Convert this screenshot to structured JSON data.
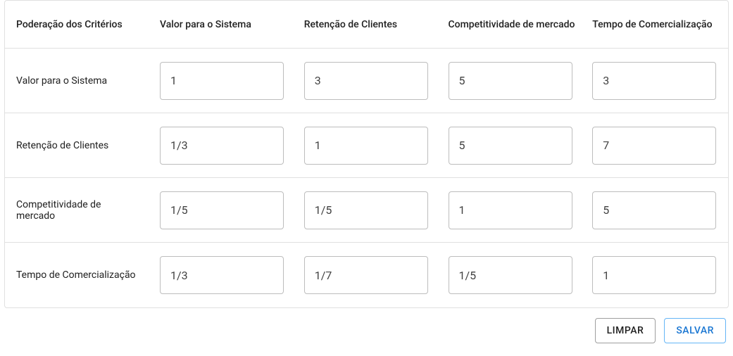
{
  "corner_label": "Poderação dos Critérios",
  "columns": [
    "Valor para o Sistema",
    "Retenção de Clientes",
    "Competitividade de mercado",
    "Tempo de Comercialização"
  ],
  "rows": [
    {
      "label": "Valor para o Sistema",
      "values": [
        "1",
        "3",
        "5",
        "3"
      ]
    },
    {
      "label": "Retenção de Clientes",
      "values": [
        "1/3",
        "1",
        "5",
        "7"
      ]
    },
    {
      "label": "Competitividade de mercado",
      "values": [
        "1/5",
        "1/5",
        "1",
        "5"
      ]
    },
    {
      "label": "Tempo de Comercialização",
      "values": [
        "1/3",
        "1/7",
        "1/5",
        "1"
      ]
    }
  ],
  "actions": {
    "clear_label": "LIMPAR",
    "save_label": "SALVAR"
  }
}
